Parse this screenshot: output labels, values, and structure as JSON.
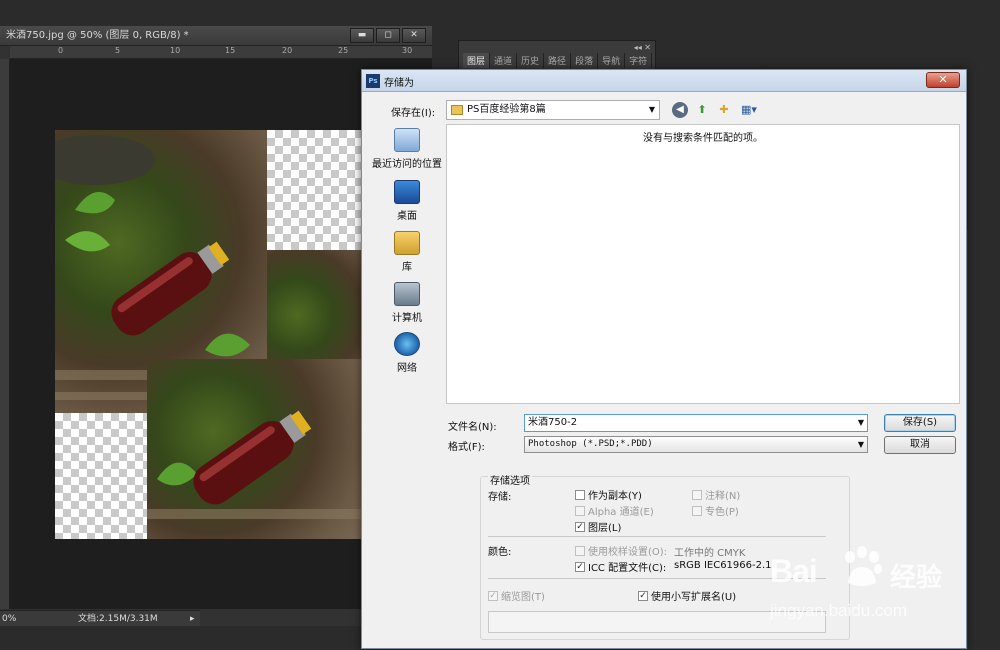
{
  "ps_document": {
    "title": "米酒750.jpg @ 50% (图层 0, RGB/8) *",
    "window_buttons": [
      "▬",
      "◻",
      "✕"
    ],
    "ruler_ticks": [
      "0",
      "5",
      "10",
      "15",
      "20",
      "25",
      "30"
    ],
    "status_zoom": "0%",
    "status_docsize": "文档:2.15M/3.31M"
  },
  "layers_panel": {
    "tabs": [
      "图层",
      "通道",
      "历史",
      "路径",
      "段落",
      "导航",
      "字符"
    ]
  },
  "dialog": {
    "title": "存储为",
    "close": "✕",
    "save_in_label": "保存在(I):",
    "save_in_value": "PS百度经验第8篇",
    "empty_message": "没有与搜索条件匹配的项。",
    "places": [
      "最近访问的位置",
      "桌面",
      "库",
      "计算机",
      "网络"
    ],
    "filename_label": "文件名(N):",
    "filename_value": "米酒750-2",
    "format_label": "格式(F):",
    "format_value": "Photoshop (*.PSD;*.PDD)",
    "save_button": "保存(S)",
    "cancel_button": "取消",
    "options_title": "存储选项",
    "storage_label": "存储:",
    "as_copy": "作为副本(Y)",
    "annotations": "注释(N)",
    "alpha_channels": "Alpha 通道(E)",
    "spot_colors": "专色(P)",
    "layers": "图层(L)",
    "color_label": "颜色:",
    "use_proof": "使用校样设置(O):",
    "proof_profile": "工作中的 CMYK",
    "icc_profile": "ICC 配置文件(C):",
    "icc_value": "sRGB IEC61966-2.1",
    "thumbnail": "缩览图(T)",
    "lowercase_ext": "使用小写扩展名(U)"
  },
  "watermark": {
    "brand_left": "Bai",
    "brand_right": "经验",
    "url": "jingyan.baidu.com"
  }
}
